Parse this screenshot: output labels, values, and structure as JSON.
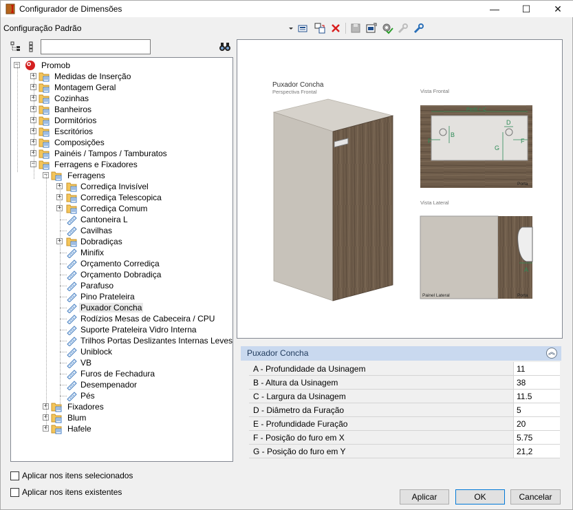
{
  "window": {
    "title": "Configurador de Dimensões",
    "minimize_glyph": "—",
    "maximize_glyph": "☐",
    "close_glyph": "✕"
  },
  "toolbar": {
    "config_label": "Configuração Padrão",
    "icons": [
      "dropdown-arrow-icon",
      "import-icon",
      "copy-config-icon",
      "delete-icon",
      "save-icon",
      "export-icon",
      "settings-check-icon",
      "tool-disabled-icon",
      "tool-icon"
    ]
  },
  "tree": {
    "search_value": "",
    "nodes": [
      {
        "label": "Promob",
        "level": 0,
        "kind": "root",
        "exp": "−"
      },
      {
        "label": "Medidas de Inserção",
        "level": 1,
        "kind": "folder",
        "exp": "+"
      },
      {
        "label": "Montagem Geral",
        "level": 1,
        "kind": "folder",
        "exp": "+"
      },
      {
        "label": "Cozinhas",
        "level": 1,
        "kind": "folder",
        "exp": "+"
      },
      {
        "label": "Banheiros",
        "level": 1,
        "kind": "folder",
        "exp": "+"
      },
      {
        "label": "Dormitórios",
        "level": 1,
        "kind": "folder",
        "exp": "+"
      },
      {
        "label": "Escritórios",
        "level": 1,
        "kind": "folder",
        "exp": "+"
      },
      {
        "label": "Composições",
        "level": 1,
        "kind": "folder",
        "exp": "+"
      },
      {
        "label": "Painéis / Tampos / Tamburatos",
        "level": 1,
        "kind": "folder",
        "exp": "+"
      },
      {
        "label": "Ferragens e Fixadores",
        "level": 1,
        "kind": "folder",
        "exp": "−"
      },
      {
        "label": "Ferragens",
        "level": 2,
        "kind": "folder",
        "exp": "−"
      },
      {
        "label": "Corrediça Invisível",
        "level": 3,
        "kind": "folder",
        "exp": "+"
      },
      {
        "label": "Corrediça Telescopica",
        "level": 3,
        "kind": "folder",
        "exp": "+"
      },
      {
        "label": "Corrediça Comum",
        "level": 3,
        "kind": "folder",
        "exp": "+"
      },
      {
        "label": "Cantoneira L",
        "level": 3,
        "kind": "item",
        "exp": ""
      },
      {
        "label": "Cavilhas",
        "level": 3,
        "kind": "item",
        "exp": ""
      },
      {
        "label": "Dobradiças",
        "level": 3,
        "kind": "folder",
        "exp": "+"
      },
      {
        "label": "Minifix",
        "level": 3,
        "kind": "item",
        "exp": ""
      },
      {
        "label": "Orçamento Corrediça",
        "level": 3,
        "kind": "item",
        "exp": ""
      },
      {
        "label": "Orçamento Dobradiça",
        "level": 3,
        "kind": "item",
        "exp": ""
      },
      {
        "label": "Parafuso",
        "level": 3,
        "kind": "item",
        "exp": ""
      },
      {
        "label": "Pino Prateleira",
        "level": 3,
        "kind": "item",
        "exp": ""
      },
      {
        "label": "Puxador Concha",
        "level": 3,
        "kind": "item",
        "exp": "",
        "selected": true
      },
      {
        "label": "Rodízios Mesas de Cabeceira / CPU",
        "level": 3,
        "kind": "item",
        "exp": ""
      },
      {
        "label": "Suporte Prateleira Vidro Interna",
        "level": 3,
        "kind": "item",
        "exp": ""
      },
      {
        "label": "Trilhos Portas Deslizantes Internas Leves",
        "level": 3,
        "kind": "item",
        "exp": ""
      },
      {
        "label": "Uniblock",
        "level": 3,
        "kind": "item",
        "exp": ""
      },
      {
        "label": "VB",
        "level": 3,
        "kind": "item",
        "exp": ""
      },
      {
        "label": "Furos de Fechadura",
        "level": 3,
        "kind": "item",
        "exp": ""
      },
      {
        "label": "Desempenador",
        "level": 3,
        "kind": "item",
        "exp": ""
      },
      {
        "label": "Pés",
        "level": 3,
        "kind": "item",
        "exp": ""
      },
      {
        "label": "Fixadores",
        "level": 2,
        "kind": "folder",
        "exp": "+"
      },
      {
        "label": "Blum",
        "level": 2,
        "kind": "folder",
        "exp": "+"
      },
      {
        "label": "Hafele",
        "level": 2,
        "kind": "folder",
        "exp": "+"
      }
    ]
  },
  "preview": {
    "title": "Puxador Concha",
    "subtitle": "Perspectiva Frontal",
    "front_view_label": "Vista Frontal",
    "side_view_label": "Vista Lateral",
    "perfil_label": "Perfil + C",
    "porta_label": "Porta",
    "painel_label": "Painel Lateral",
    "dims": {
      "A": "A",
      "B": "B",
      "D": "D",
      "F": "F",
      "G": "G"
    }
  },
  "properties": {
    "header": "Puxador Concha",
    "collapse_glyph": "︽",
    "rows": [
      {
        "name": "A - Profundidade da Usinagem",
        "value": "11"
      },
      {
        "name": "B - Altura da Usinagem",
        "value": "38"
      },
      {
        "name": "C - Largura da Usinagem",
        "value": "11.5"
      },
      {
        "name": "D - Diâmetro da Furação",
        "value": "5"
      },
      {
        "name": "E - Profundidade Furação",
        "value": "20"
      },
      {
        "name": "F - Posição do furo em X",
        "value": "5.75"
      },
      {
        "name": "G - Posição do furo em Y",
        "value": "21,2"
      }
    ]
  },
  "options": {
    "apply_selected": "Aplicar nos itens selecionados",
    "apply_existing": "Aplicar nos itens existentes"
  },
  "buttons": {
    "apply": "Aplicar",
    "ok": "OK",
    "cancel": "Cancelar"
  },
  "colors": {
    "accent": "#0078d7",
    "dimension_green": "#2e8b57",
    "wood": "#6b5a48",
    "panel": "#c9c4bc"
  }
}
